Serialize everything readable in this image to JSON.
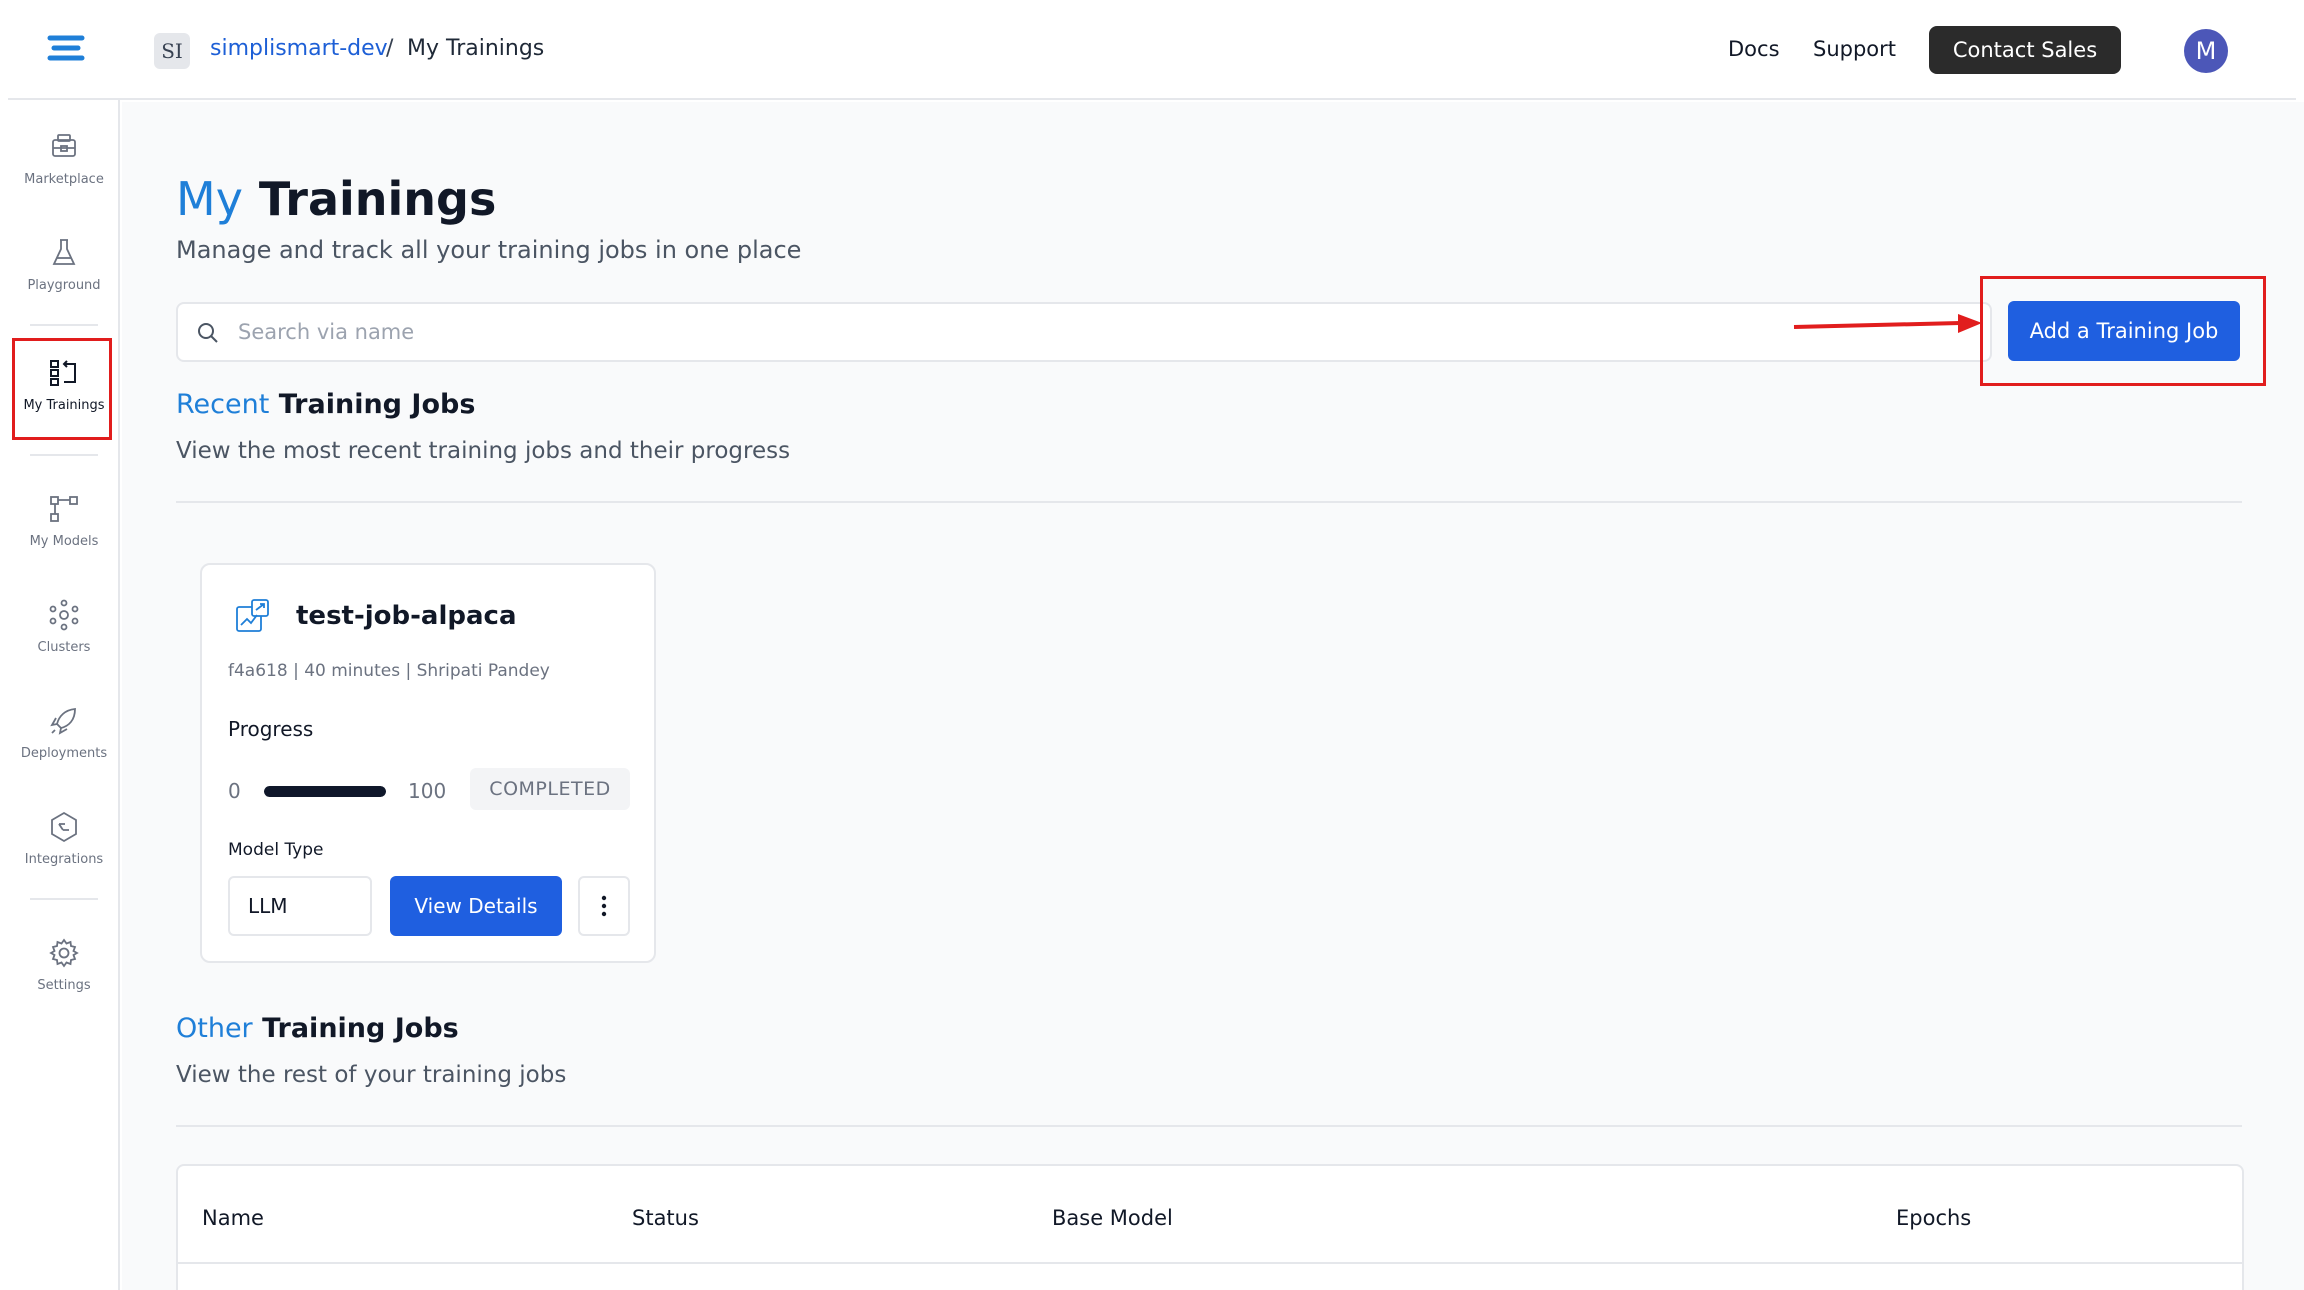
{
  "header": {
    "org_initials": "SI",
    "org_name": "simplismart-dev",
    "separator": "/",
    "current_page": "My Trainings",
    "docs_label": "Docs",
    "support_label": "Support",
    "contact_sales_label": "Contact Sales",
    "avatar_initial": "M"
  },
  "sidebar": {
    "items": [
      {
        "label": "Marketplace",
        "icon": "marketplace-icon"
      },
      {
        "label": "Playground",
        "icon": "flask-icon"
      },
      {
        "label": "My Trainings",
        "icon": "trainings-icon",
        "active": true
      },
      {
        "label": "My Models",
        "icon": "models-icon"
      },
      {
        "label": "Clusters",
        "icon": "clusters-icon"
      },
      {
        "label": "Deployments",
        "icon": "rocket-icon"
      },
      {
        "label": "Integrations",
        "icon": "integrations-icon"
      },
      {
        "label": "Settings",
        "icon": "gear-icon"
      }
    ]
  },
  "page": {
    "title_accent": "My",
    "title_rest": " Trainings",
    "subtitle": "Manage and track all your training jobs in one place",
    "search_placeholder": "Search via name",
    "add_button_label": "Add a Training Job"
  },
  "recent": {
    "title_accent": "Recent",
    "title_rest": " Training Jobs",
    "subtitle": "View the most recent training jobs and their progress",
    "jobs": [
      {
        "name": "test-job-alpaca",
        "meta": "f4a618 | 40 minutes | Shripati Pandey",
        "progress_label": "Progress",
        "progress_min": "0",
        "progress_max": "100",
        "progress_value": 100,
        "status": "COMPLETED",
        "model_type_label": "Model Type",
        "model_type": "LLM",
        "details_label": "View Details"
      }
    ]
  },
  "other": {
    "title_accent": "Other",
    "title_rest": " Training Jobs",
    "subtitle": "View the rest of your training jobs",
    "columns": [
      "Name",
      "Status",
      "Base Model",
      "Epochs"
    ]
  },
  "colors": {
    "accent_blue": "#1f7fd8",
    "primary_button": "#1f5fe0",
    "annotation_red": "#e11d1d"
  }
}
